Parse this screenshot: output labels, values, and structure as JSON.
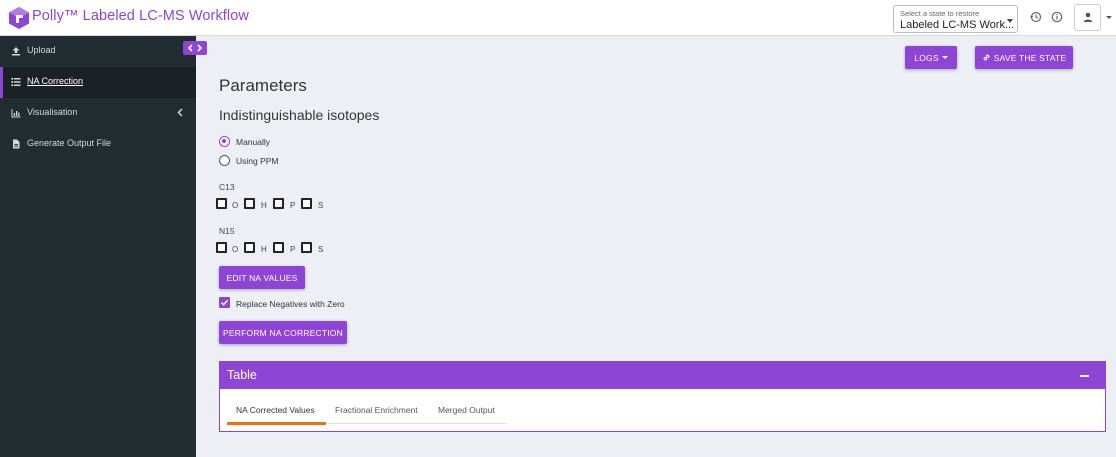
{
  "header": {
    "app_title": "Polly™ Labeled LC-MS Workflow",
    "state_select": {
      "label": "Select a state to restore",
      "value": "Labeled LC-MS Work..."
    },
    "icons": [
      "history-icon",
      "info-icon",
      "user-icon"
    ]
  },
  "sidebar": {
    "items": [
      {
        "label": "Upload",
        "icon": "upload-icon"
      },
      {
        "label": "NA Correction",
        "icon": "list-icon",
        "active": true
      },
      {
        "label": "Visualisation",
        "icon": "chart-icon"
      },
      {
        "label": "Generate Output File",
        "icon": "file-icon"
      }
    ]
  },
  "toolbar": {
    "logs_label": "LOGS",
    "save_label": "SAVE THE STATE"
  },
  "main": {
    "title": "Parameters",
    "section_title": "Indistinguishable isotopes",
    "radio_options": [
      {
        "label": "Manually",
        "checked": true
      },
      {
        "label": "Using PPM",
        "checked": false
      }
    ],
    "groups": [
      {
        "label": "C13",
        "options": [
          "O",
          "H",
          "P",
          "S"
        ]
      },
      {
        "label": "N15",
        "options": [
          "O",
          "H",
          "P",
          "S"
        ]
      }
    ],
    "edit_na_label": "EDIT NA VALUES",
    "replace_negatives_label": "Replace Negatives with Zero",
    "replace_negatives_checked": true,
    "perform_label": "PERFORM NA CORRECTION"
  },
  "table_panel": {
    "title": "Table",
    "tabs": [
      {
        "label": "NA Corrected Values",
        "active": true
      },
      {
        "label": "Fractional Enrichment"
      },
      {
        "label": "Merged Output"
      }
    ]
  },
  "colors": {
    "accent": "#8e44d4",
    "sidebar_bg": "#222d32",
    "content_bg": "#ecf0f5",
    "tab_underline": "#e8730e"
  }
}
